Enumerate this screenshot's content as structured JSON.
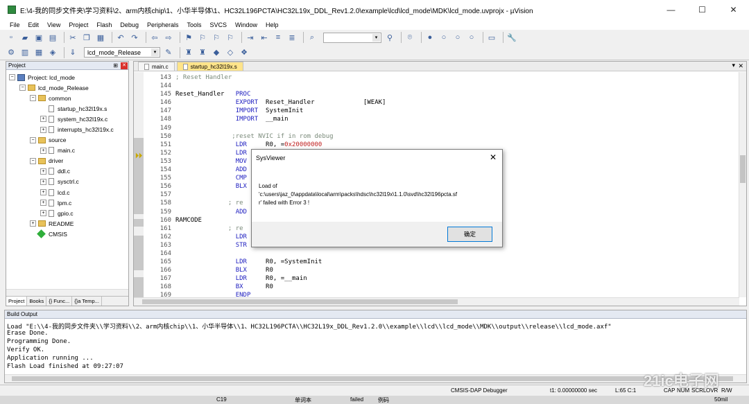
{
  "window": {
    "title": "E:\\4-我的同步文件夹\\学习资料\\2、arm内核chip\\1、小华半导体\\1、HC32L196PCTA\\HC32L19x_DDL_Rev1.2.0\\example\\lcd\\lcd_mode\\MDK\\lcd_mode.uvprojx - µVision",
    "minimize": "—",
    "maximize": "☐",
    "close": "✕"
  },
  "menu": [
    "File",
    "Edit",
    "View",
    "Project",
    "Flash",
    "Debug",
    "Peripherals",
    "Tools",
    "SVCS",
    "Window",
    "Help"
  ],
  "toolbar": {
    "target": "lcd_mode_Release"
  },
  "project_panel": {
    "title": "Project",
    "tree": [
      {
        "label": "Project: lcd_mode",
        "level": 0,
        "kind": "project",
        "toggle": "−"
      },
      {
        "label": "lcd_mode_Release",
        "level": 1,
        "kind": "folder",
        "toggle": "−"
      },
      {
        "label": "common",
        "level": 2,
        "kind": "folder",
        "toggle": "−"
      },
      {
        "label": "startup_hc32l19x.s",
        "level": 3,
        "kind": "file",
        "toggle": ""
      },
      {
        "label": "system_hc32l19x.c",
        "level": 3,
        "kind": "file",
        "toggle": "+"
      },
      {
        "label": "interrupts_hc32l19x.c",
        "level": 3,
        "kind": "file",
        "toggle": "+"
      },
      {
        "label": "source",
        "level": 2,
        "kind": "folder",
        "toggle": "−"
      },
      {
        "label": "main.c",
        "level": 3,
        "kind": "file",
        "toggle": "+"
      },
      {
        "label": "driver",
        "level": 2,
        "kind": "folder",
        "toggle": "−"
      },
      {
        "label": "ddl.c",
        "level": 3,
        "kind": "file",
        "toggle": "+"
      },
      {
        "label": "sysctrl.c",
        "level": 3,
        "kind": "file",
        "toggle": "+"
      },
      {
        "label": "lcd.c",
        "level": 3,
        "kind": "file",
        "toggle": "+"
      },
      {
        "label": "lpm.c",
        "level": 3,
        "kind": "file",
        "toggle": "+"
      },
      {
        "label": "gpio.c",
        "level": 3,
        "kind": "file",
        "toggle": "+"
      },
      {
        "label": "README",
        "level": 2,
        "kind": "folder",
        "toggle": "+"
      },
      {
        "label": "CMSIS",
        "level": 2,
        "kind": "gem",
        "toggle": ""
      }
    ],
    "tabs": [
      "Project",
      "Books",
      "{} Func...",
      "{}a Temp..."
    ]
  },
  "editor": {
    "tabs": [
      {
        "label": "main.c",
        "active": false
      },
      {
        "label": "startup_hc32l19x.s",
        "active": true
      }
    ],
    "line_numbers": [
      "143",
      "144",
      "145",
      "146",
      "147",
      "148",
      "149",
      "150",
      "151",
      "152",
      "153",
      "154",
      "155",
      "156",
      "157",
      "158",
      "159",
      "160",
      "161",
      "162",
      "163",
      "164",
      "165",
      "166",
      "167",
      "168",
      "169"
    ],
    "code": [
      "; Reset Handler",
      "",
      "Reset_Handler   PROC",
      "                EXPORT  Reset_Handler             [WEAK]",
      "                IMPORT  SystemInit",
      "                IMPORT  __main",
      "",
      "               ;reset NVIC if in rom debug",
      "                LDR     R0, =0x20000000",
      "                LDR",
      "                MOV",
      "                ADD",
      "                CMP",
      "                BLX",
      "",
      "              ; re",
      "                ADD",
      "RAMCODE",
      "              ; re",
      "                LDR",
      "                STR",
      "",
      "                LDR     R0, =SystemInit",
      "                BLX     R0",
      "                LDR     R0, =__main",
      "                BX      R0",
      "                ENDP"
    ],
    "marker_glyph": "⏵⏵"
  },
  "dialog": {
    "title": "SysViewer",
    "close": "✕",
    "message": [
      "Load of",
      "'c:\\users\\jaz_0\\appdata\\local\\arm\\packs\\hdsc\\hc32l19x\\1.1.0\\svd\\hc32l196pcta.sf",
      "r' failed with Error 3 !"
    ],
    "ok_label": "确定"
  },
  "build_output": {
    "title": "Build Output",
    "lines": [
      "Load \"E:\\\\4-我的同步文件夹\\\\学习资料\\\\2、arm内核chip\\\\1、小华半导体\\\\1、HC32L196PCTA\\\\HC32L19x_DDL_Rev1.2.0\\\\example\\\\lcd\\\\lcd_mode\\\\MDK\\\\output\\\\release\\\\lcd_mode.axf\"",
      "Erase Done.",
      "Programming Done.",
      "Verify OK.",
      "Application running ...",
      "Flash Load finished at 09:27:07"
    ]
  },
  "status": {
    "debugger": "CMSIS-DAP Debugger",
    "time": "t1: 0.00000000 sec",
    "position": "L:65 C:1",
    "caps": "CAP",
    "num": "NUM",
    "scrl": "SCRL",
    "ovr": "OVR",
    "rw": "R/W"
  },
  "taskbar": {
    "item1": "C19",
    "item2": "单词本",
    "item3": "failed",
    "item4": "例码",
    "item5": "50mil"
  },
  "watermark": "21ic电子网"
}
